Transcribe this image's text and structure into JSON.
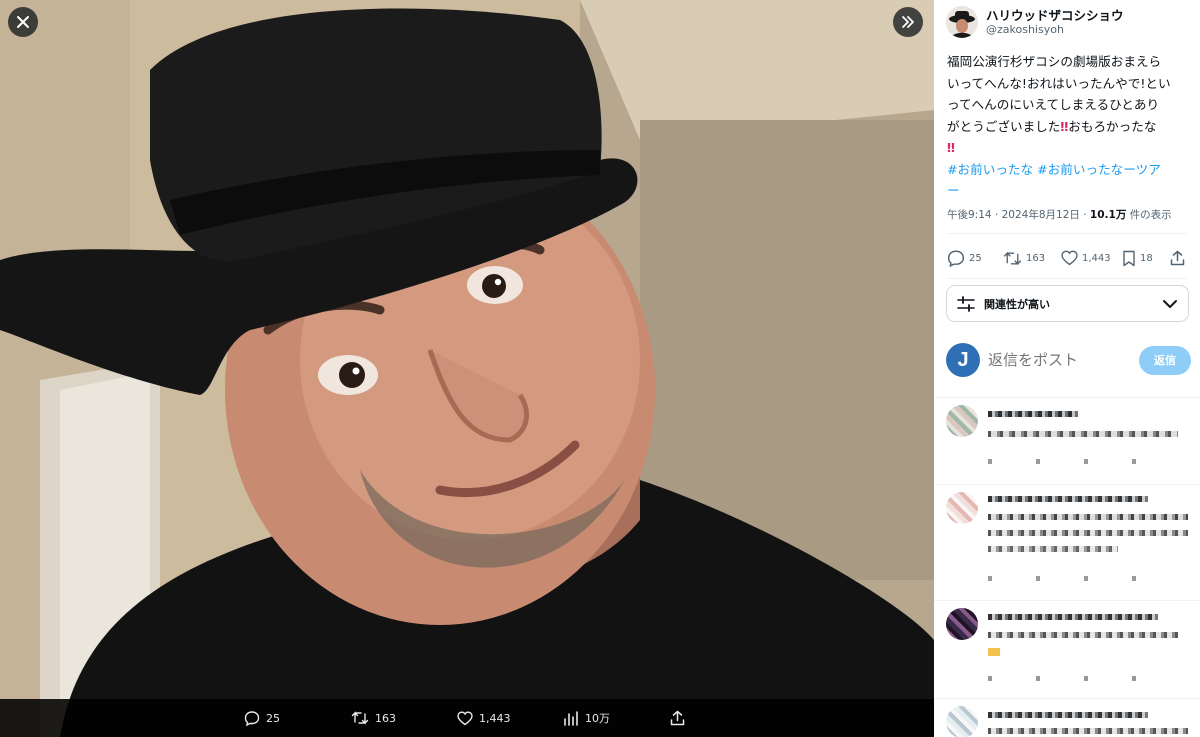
{
  "viewer": {
    "close_label": "close",
    "next_label": "next",
    "icons": {
      "close": "close-icon",
      "next": "double-chevron-right-icon"
    }
  },
  "media_bar": {
    "replies": "25",
    "reposts": "163",
    "likes": "1,443",
    "views": "10万"
  },
  "tweet": {
    "author_name": "ハリウッドザコシショウ",
    "author_handle": "@zakoshisyoh",
    "text_line1": "福岡公演行杉ザコシの劇場版おまえら",
    "text_line2": "いってへんな!おれはいったんやで!とい",
    "text_line3": "ってへんのにいえてしまえるひとあり",
    "text_line4_pre": "がとうございました",
    "text_line4_post": "おもろかったな",
    "bang": "‼",
    "hashtag1": "#お前いったな",
    "hashtag2": "#お前いったなーツア",
    "hashtag2_cont": "ー",
    "time": "午後9:14",
    "date": "2024年8月12日",
    "views_count": "10.1万",
    "views_label": "件の表示",
    "sep": "·"
  },
  "actions": {
    "replies": "25",
    "reposts": "163",
    "likes": "1,443",
    "bookmarks": "18"
  },
  "sort": {
    "label": "関連性が高い"
  },
  "compose": {
    "avatar_letter": "J",
    "placeholder": "返信をポスト",
    "button": "返信"
  },
  "colors": {
    "accent": "#1d9bf0",
    "reply_button": "#8ecdf8",
    "bang": "#e0245e",
    "my_avatar": "#2f6fb5"
  }
}
